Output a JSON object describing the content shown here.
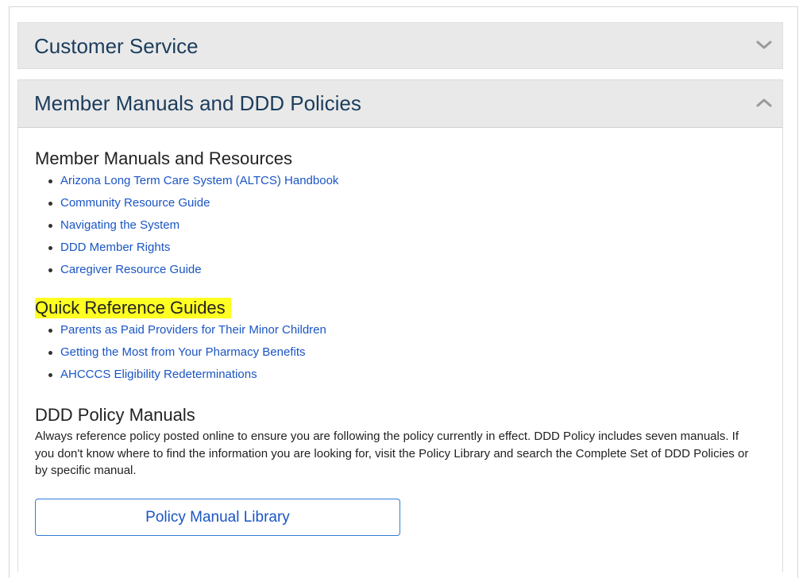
{
  "accordion": {
    "sections": [
      {
        "title": "Customer Service",
        "state": "collapsed",
        "icon": "chevron-down-icon"
      },
      {
        "title": "Member Manuals and DDD Policies",
        "state": "expanded",
        "icon": "chevron-up-icon"
      }
    ]
  },
  "content": {
    "resources": {
      "heading": "Member Manuals and Resources",
      "links": [
        "Arizona Long Term Care System (ALTCS) Handbook",
        "Community Resource Guide",
        "Navigating the System",
        "DDD Member Rights",
        "Caregiver Resource Guide"
      ]
    },
    "quick": {
      "heading": "Quick Reference Guides",
      "highlight_color": "#ffff22",
      "links": [
        "Parents as Paid Providers for Their Minor Children",
        "Getting the Most from Your Pharmacy Benefits",
        "AHCCCS Eligibility Redeterminations"
      ]
    },
    "policy": {
      "heading": "DDD Policy Manuals",
      "description": "Always reference policy posted online to ensure you are following the policy currently in effect. DDD Policy includes seven manuals. If you don't know where to find the information you are looking for, visit the Policy Library and search the Complete Set of DDD Policies or by specific manual.",
      "button_label": "Policy Manual Library"
    }
  },
  "colors": {
    "link": "#1a55c4",
    "panel_title": "#1c3d5c",
    "panel_bg": "#e9e9e9",
    "button_border": "#2f7bd6"
  }
}
